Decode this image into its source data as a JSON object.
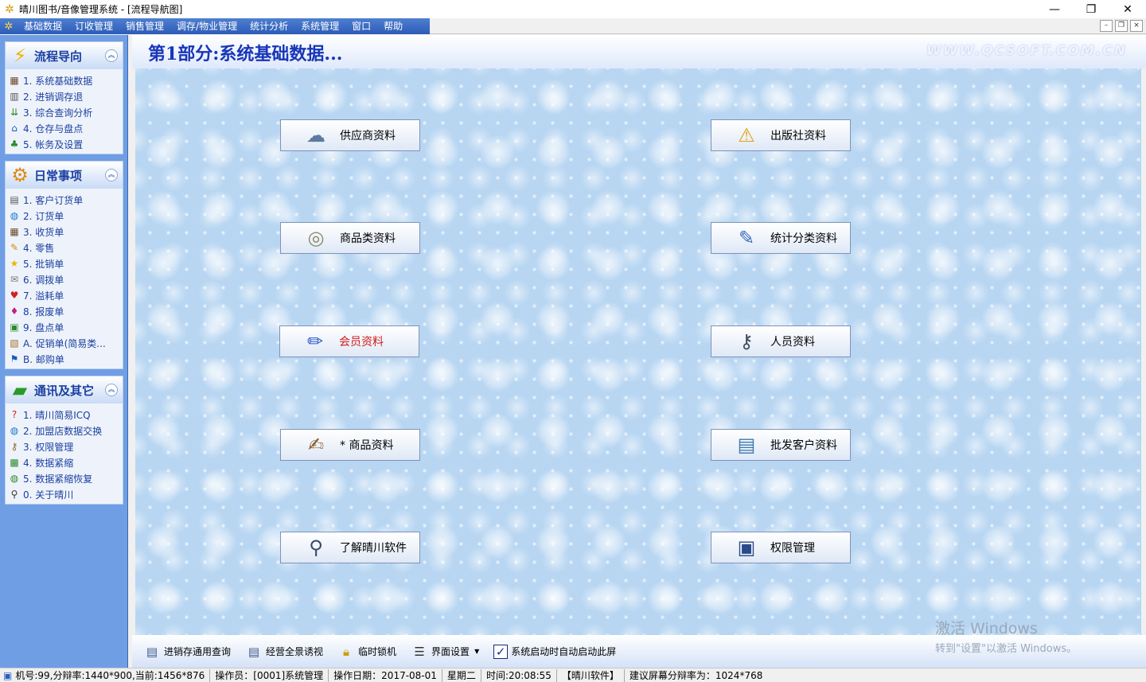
{
  "window": {
    "title": "晴川图书/音像管理系统 - [流程导航图]",
    "buttons": [
      "—",
      "❐",
      "✕"
    ]
  },
  "menu": {
    "items": [
      "基础数据",
      "订收管理",
      "销售管理",
      "调存/物业管理",
      "统计分析",
      "系统管理",
      "窗口",
      "帮助"
    ],
    "mdi_buttons": [
      "–",
      "❐",
      "×"
    ]
  },
  "sidebar": {
    "panels": [
      {
        "title": "流程导向",
        "items": [
          "1. 系统基础数据",
          "2. 进销调存退",
          "3. 综合查询分析",
          "4. 仓存与盘点",
          "5. 帐务及设置"
        ]
      },
      {
        "title": "日常事项",
        "items": [
          "1. 客户订货单",
          "2. 订货单",
          "3. 收货单",
          "4. 零售",
          "5. 批销单",
          "6. 调拨单",
          "7. 溢耗单",
          "8. 报废单",
          "9. 盘点单",
          "A. 促销单(简易类...",
          "B. 邮购单"
        ]
      },
      {
        "title": "通讯及其它",
        "items": [
          "1. 晴川简易ICQ",
          "2. 加盟店数据交换",
          "3. 权限管理",
          "4. 数据紧缩",
          "5. 数据紧缩恢复",
          "0. 关于晴川"
        ]
      }
    ]
  },
  "main": {
    "section_title": "第1部分:系统基础数据...",
    "watermark": "WWW.QCSOFT.COM.CN",
    "buttons": [
      {
        "label": "供应商资料",
        "icon": "supplier-icon"
      },
      {
        "label": "出版社资料",
        "icon": "publisher-icon"
      },
      {
        "label": "商品类资料",
        "icon": "category-icon"
      },
      {
        "label": "统计分类资料",
        "icon": "stat-category-icon"
      },
      {
        "label": "会员资料",
        "icon": "member-icon"
      },
      {
        "label": "人员资料",
        "icon": "staff-icon"
      },
      {
        "label": "* 商品资料",
        "icon": "product-icon"
      },
      {
        "label": "批发客户资料",
        "icon": "wholesale-client-icon"
      },
      {
        "label": "了解晴川软件",
        "icon": "about-icon"
      },
      {
        "label": "权限管理",
        "icon": "permission-icon"
      }
    ]
  },
  "toolbar": {
    "items": [
      "进销存通用查询",
      "经营全景诱视",
      "临时锁机",
      "界面设置"
    ],
    "checkbox_label": "系统启动时自动启动此屏"
  },
  "activation": {
    "line1": "激活 Windows",
    "line2": "转到\"设置\"以激活 Windows。"
  },
  "status": {
    "machine": "机号:99,分辩率:1440*900,当前:1456*876",
    "operator": "操作员：[0001]系统管理",
    "date": "操作日期：2017-08-01",
    "weekday": "星期二",
    "time": "时间:20:08:55",
    "company": "【晴川软件】",
    "recommend": "建议屏幕分辩率为：1024*768"
  }
}
